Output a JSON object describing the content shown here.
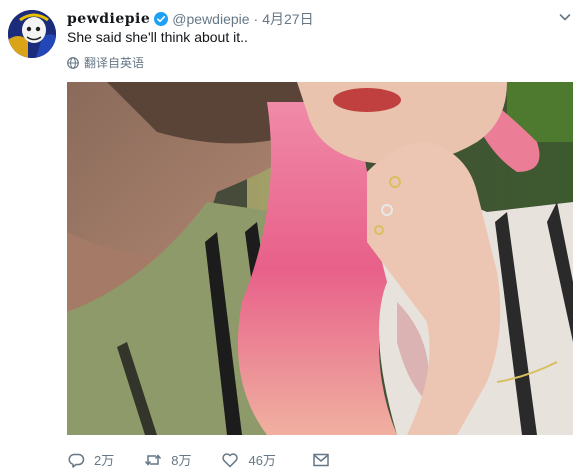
{
  "tweet": {
    "display_name": "pewdiepie",
    "handle": "@pewdiepie",
    "separator": "·",
    "date": "4月27日",
    "text": "She said she'll think about it..",
    "translate_label": "翻译自英语",
    "icons": {
      "verified": "verified-badge-icon",
      "menu": "chevron-down-icon",
      "translate": "globe-icon"
    }
  },
  "actions": {
    "reply_count": "2万",
    "retweet_count": "8万",
    "like_count": "46万"
  },
  "colors": {
    "verified": "#1da1f2",
    "secondary_text": "#657786",
    "primary_text": "#14171a"
  }
}
